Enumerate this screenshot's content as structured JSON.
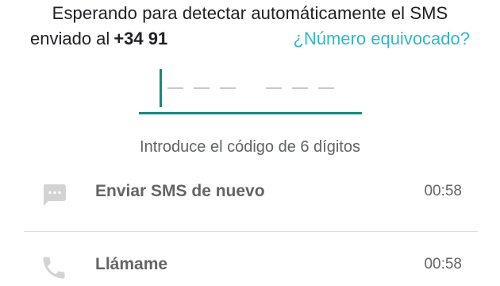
{
  "verification": {
    "message_line1": "Esperando para detectar automáticamente el SMS",
    "message_prefix": "enviado al",
    "phone_number": "+34 91",
    "wrong_number_link": "¿Número equivocado?"
  },
  "code_input": {
    "hint": "Introduce el código de 6 dígitos",
    "digits": [
      "",
      "",
      "",
      "",
      "",
      ""
    ]
  },
  "actions": [
    {
      "label": "Enviar SMS de nuevo",
      "timer": "00:58",
      "icon": "message-icon"
    },
    {
      "label": "Llámame",
      "timer": "00:58",
      "icon": "phone-icon"
    }
  ],
  "colors": {
    "accent": "#128c7e",
    "link": "#34b7c7",
    "disabled_text": "#646464",
    "icon_gray": "#d3d3d3"
  }
}
